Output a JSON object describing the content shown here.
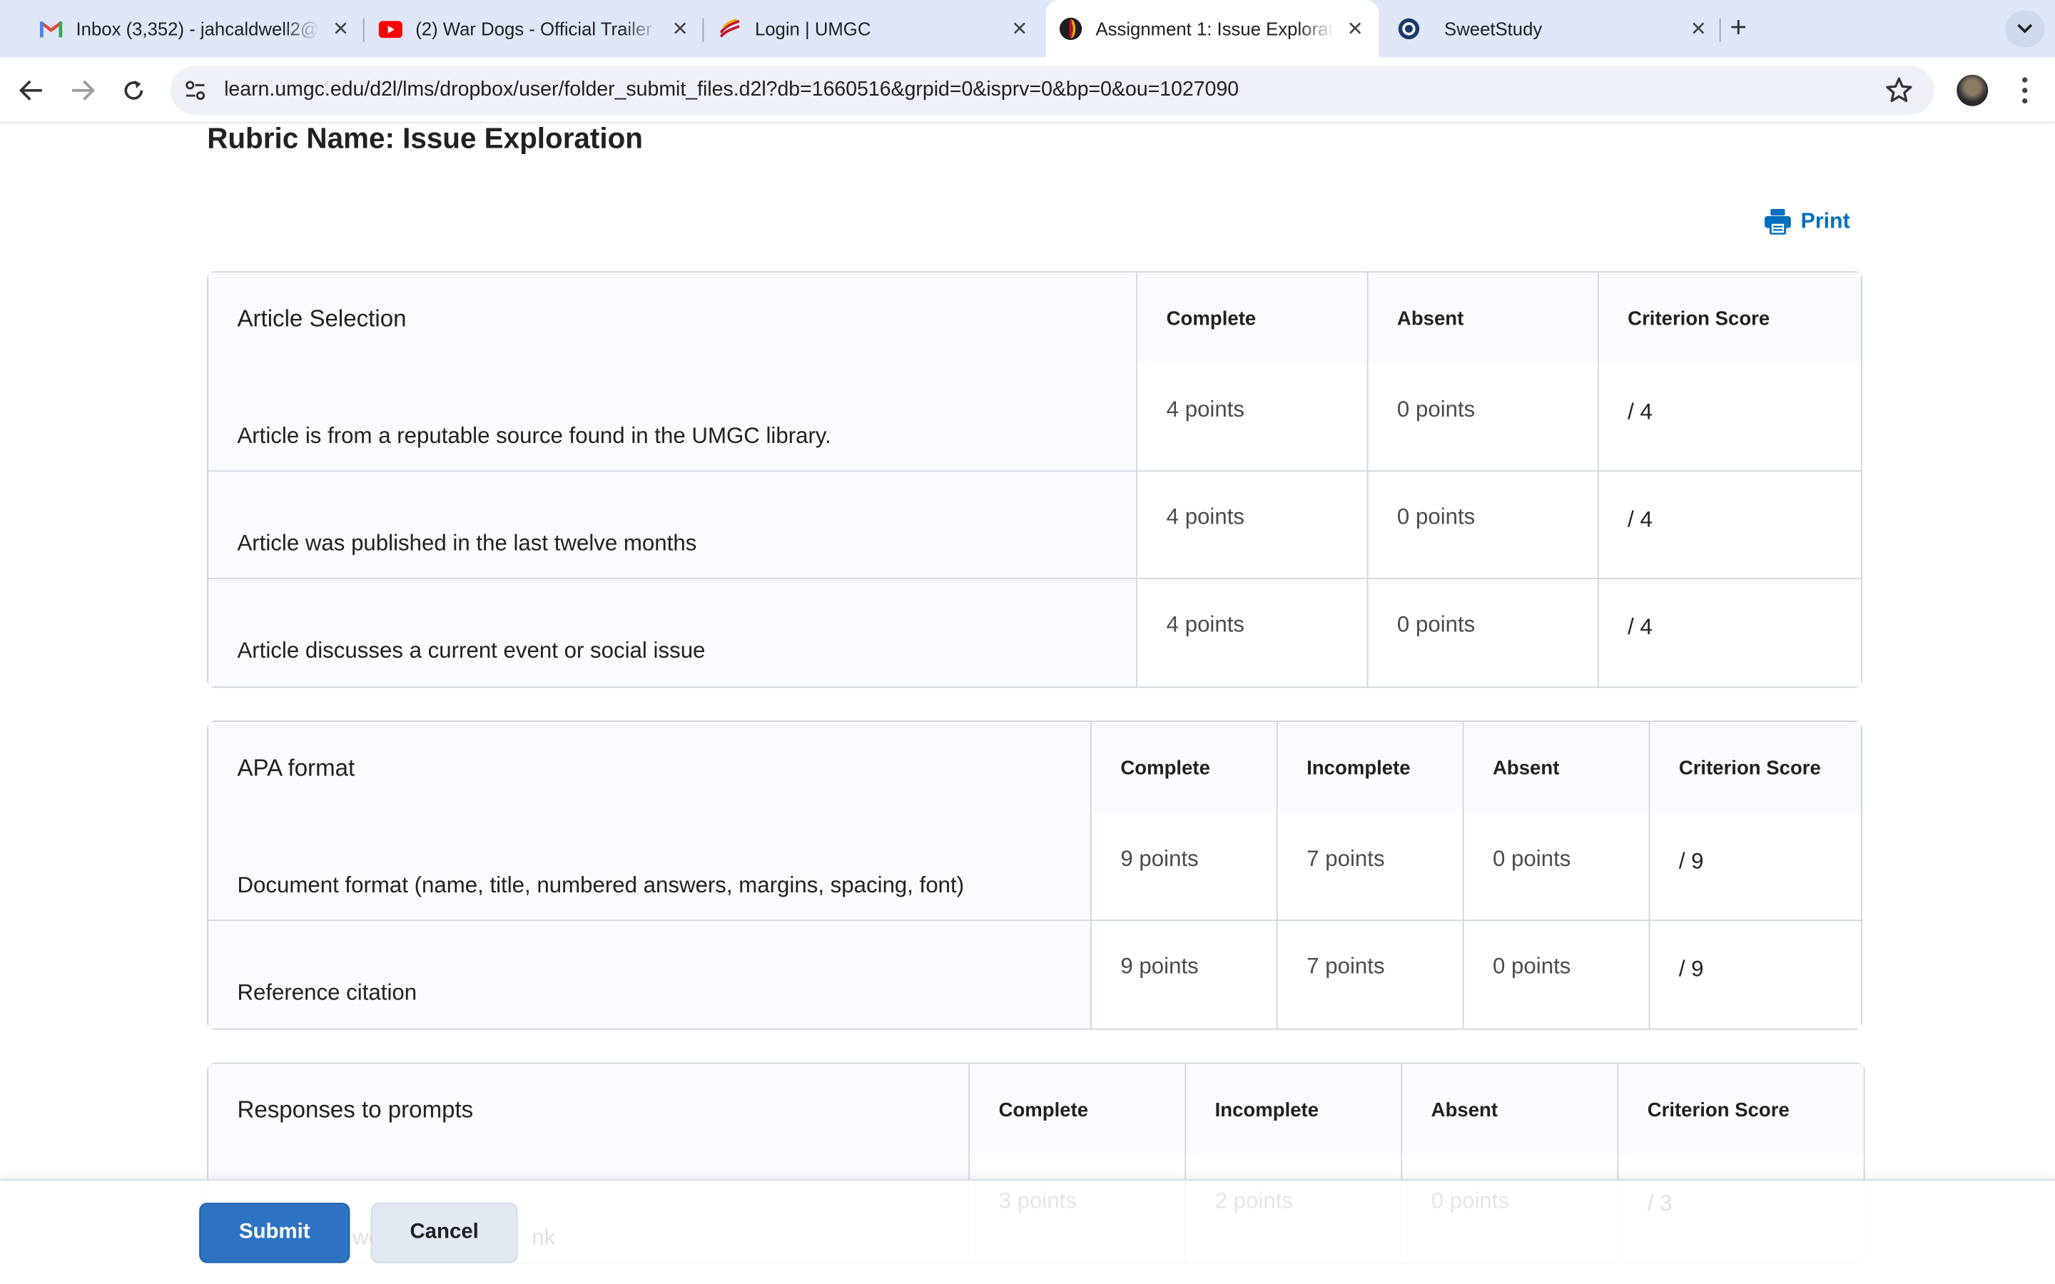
{
  "browser": {
    "tabs": [
      {
        "title": "Inbox (3,352) - jahcaldwell2@",
        "icon": "gmail-icon",
        "active": false
      },
      {
        "title": "(2) War Dogs - Official Trailer",
        "icon": "youtube-icon",
        "active": false
      },
      {
        "title": "Login | UMGC",
        "icon": "umgc-icon",
        "active": false
      },
      {
        "title": "Assignment 1: Issue Exploration",
        "icon": "d2l-icon",
        "active": true
      },
      {
        "title": "SweetStudy",
        "icon": "sweetstudy-icon",
        "active": false
      }
    ],
    "url": "learn.umgc.edu/d2l/lms/dropbox/user/folder_submit_files.d2l?db=1660516&grpid=0&isprv=0&bp=0&ou=1027090",
    "colors": {
      "tabstrip": "#dfe7f7",
      "omnibox": "#eef1f7"
    }
  },
  "page": {
    "rubric_name": "Rubric Name: Issue Exploration",
    "print_label": "Print",
    "accent_color": "#006fbf"
  },
  "rubric": {
    "article": {
      "criterion": "Article Selection",
      "levels": [
        "Complete",
        "Absent"
      ],
      "score_header": "Criterion Score",
      "rows": [
        {
          "text": "Article is from a reputable source found in the UMGC library.",
          "points": [
            "4 points",
            "0 points"
          ],
          "score": "/ 4"
        },
        {
          "text": "Article was published in the last twelve months",
          "points": [
            "4 points",
            "0 points"
          ],
          "score": "/ 4"
        },
        {
          "text": "Article discusses a current event or social issue",
          "points": [
            "4 points",
            "0 points"
          ],
          "score": "/ 4"
        }
      ]
    },
    "apa": {
      "criterion": "APA format",
      "levels": [
        "Complete",
        "Incomplete",
        "Absent"
      ],
      "score_header": "Criterion Score",
      "rows": [
        {
          "text": "Document format (name, title, numbered answers, margins, spacing, font)",
          "points": [
            "9 points",
            "7 points",
            "0 points"
          ],
          "score": "/ 9"
        },
        {
          "text": "Reference citation",
          "points": [
            "9 points",
            "7 points",
            "0 points"
          ],
          "score": "/ 9"
        }
      ]
    },
    "responses": {
      "criterion": "Responses to prompts",
      "levels": [
        "Complete",
        "Incomplete",
        "Absent"
      ],
      "score_header": "Criterion Score",
      "rows": [
        {
          "text": "wo",
          "text_tail": "nk",
          "points": [
            "3 points",
            "2 points",
            "0 points"
          ],
          "score": "/ 3"
        }
      ]
    }
  },
  "footer": {
    "submit_label": "Submit",
    "cancel_label": "Cancel",
    "submit_color": "#2e73c3"
  }
}
